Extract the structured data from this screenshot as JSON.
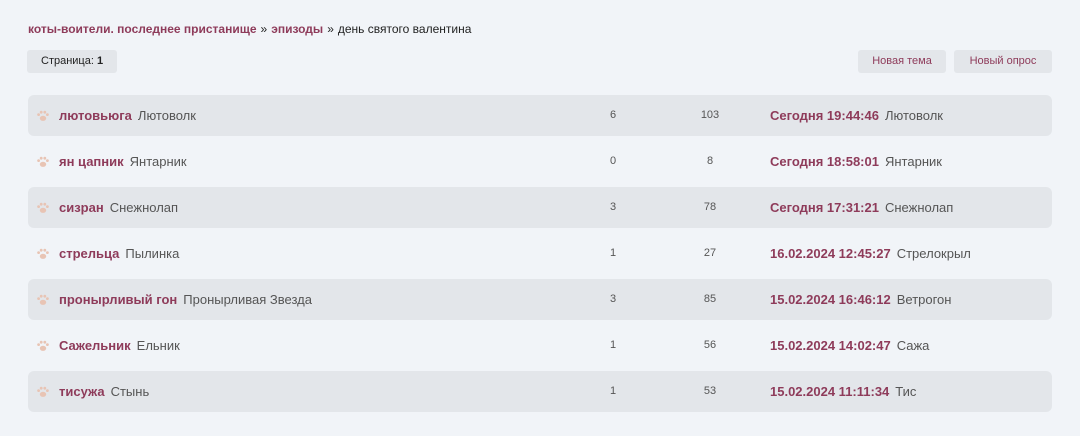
{
  "breadcrumb": {
    "forum": "коты-воители. последнее пристанище",
    "section": "эпизоды",
    "current": "день святого валентина",
    "separator": "»"
  },
  "pager": {
    "label": "Страница:",
    "page": "1"
  },
  "actions": {
    "new_topic": "Новая тема",
    "new_poll": "Новый опрос"
  },
  "colors": {
    "accent": "#8e3b5a",
    "row_shade": "#e3e6ea",
    "background": "#f1f4f8",
    "paw": "#e8c4b4"
  },
  "icons": {
    "topic": "paw-icon"
  },
  "topics": [
    {
      "title": "лютовьюга",
      "author": "Лютоволк",
      "replies": "6",
      "views": "103",
      "last_date": "Сегодня 19:44:46",
      "last_author": "Лютоволк"
    },
    {
      "title": "ян цапник",
      "author": "Янтарник",
      "replies": "0",
      "views": "8",
      "last_date": "Сегодня 18:58:01",
      "last_author": "Янтарник"
    },
    {
      "title": "сизран",
      "author": "Снежнолап",
      "replies": "3",
      "views": "78",
      "last_date": "Сегодня 17:31:21",
      "last_author": "Снежнолап"
    },
    {
      "title": "стрельца",
      "author": "Пылинка",
      "replies": "1",
      "views": "27",
      "last_date": "16.02.2024 12:45:27",
      "last_author": "Стрелокрыл"
    },
    {
      "title": "пронырливый гон",
      "author": "Пронырливая Звезда",
      "replies": "3",
      "views": "85",
      "last_date": "15.02.2024 16:46:12",
      "last_author": "Ветрогон"
    },
    {
      "title": "Сажельник",
      "author": "Ельник",
      "replies": "1",
      "views": "56",
      "last_date": "15.02.2024 14:02:47",
      "last_author": "Сажа"
    },
    {
      "title": "тисужа",
      "author": "Стынь",
      "replies": "1",
      "views": "53",
      "last_date": "15.02.2024 11:11:34",
      "last_author": "Тис"
    }
  ]
}
